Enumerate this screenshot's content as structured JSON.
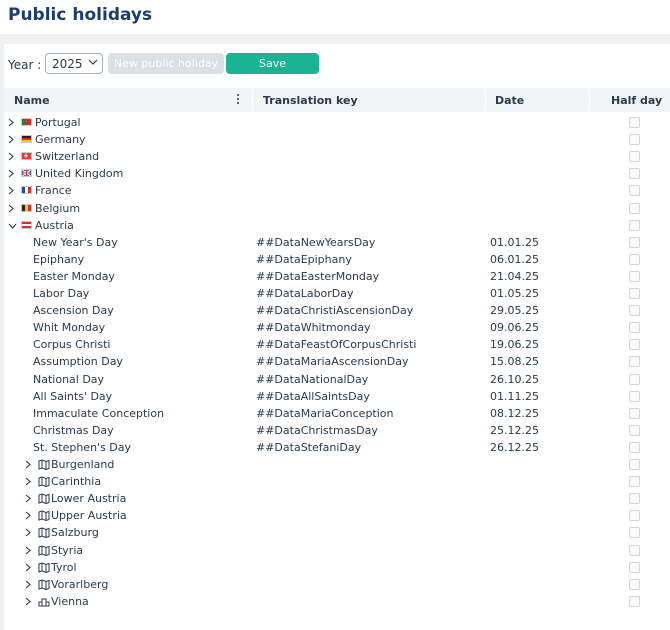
{
  "page": {
    "title": "Public holidays"
  },
  "toolbar": {
    "year_label": "Year :",
    "year_value": "2025",
    "new_button": "New public holiday",
    "save_button": "Save"
  },
  "columns": {
    "name": "Name",
    "translation_key": "Translation key",
    "date": "Date",
    "half_day": "Half day"
  },
  "countries": [
    {
      "name": "Portugal",
      "flag": "portugal"
    },
    {
      "name": "Germany",
      "flag": "germany"
    },
    {
      "name": "Switzerland",
      "flag": "switzerland"
    },
    {
      "name": "United Kingdom",
      "flag": "united-kingdom"
    },
    {
      "name": "France",
      "flag": "france"
    },
    {
      "name": "Belgium",
      "flag": "belgium"
    },
    {
      "name": "Austria",
      "flag": "austria"
    }
  ],
  "holidays": [
    {
      "name": "New Year's Day",
      "key": "##DataNewYearsDay",
      "date": "01.01.25"
    },
    {
      "name": "Epiphany",
      "key": "##DataEpiphany",
      "date": "06.01.25"
    },
    {
      "name": "Easter Monday",
      "key": "##DataEasterMonday",
      "date": "21.04.25"
    },
    {
      "name": "Labor Day",
      "key": "##DataLaborDay",
      "date": "01.05.25"
    },
    {
      "name": "Ascension Day",
      "key": "##DataChristiAscensionDay",
      "date": "29.05.25"
    },
    {
      "name": "Whit Monday",
      "key": "##DataWhitmonday",
      "date": "09.06.25"
    },
    {
      "name": "Corpus Christi",
      "key": "##DataFeastOfCorpusChristi",
      "date": "19.06.25"
    },
    {
      "name": "Assumption Day",
      "key": "##DataMariaAscensionDay",
      "date": "15.08.25"
    },
    {
      "name": "National Day",
      "key": "##DataNationalDay",
      "date": "26.10.25"
    },
    {
      "name": "All Saints' Day",
      "key": "##DataAllSaintsDay",
      "date": "01.11.25"
    },
    {
      "name": "Immaculate Conception",
      "key": "##DataMariaConception",
      "date": "08.12.25"
    },
    {
      "name": "Christmas Day",
      "key": "##DataChristmasDay",
      "date": "25.12.25"
    },
    {
      "name": "St. Stephen's Day",
      "key": "##DataStefaniDay",
      "date": "26.12.25"
    }
  ],
  "regions": [
    {
      "name": "Burgenland",
      "icon": "map-icon"
    },
    {
      "name": "Carinthia",
      "icon": "map-icon"
    },
    {
      "name": "Lower Austria",
      "icon": "map-icon"
    },
    {
      "name": "Upper Austria",
      "icon": "map-icon"
    },
    {
      "name": "Salzburg",
      "icon": "map-icon"
    },
    {
      "name": "Styria",
      "icon": "map-icon"
    },
    {
      "name": "Tyrol",
      "icon": "map-icon"
    },
    {
      "name": "Vorarlberg",
      "icon": "map-icon"
    },
    {
      "name": "Vienna",
      "icon": "city-icon"
    }
  ],
  "colors": {
    "accent": "#1ab394",
    "title": "#1d3c6e",
    "disabled_button": "#dcdfe3"
  }
}
